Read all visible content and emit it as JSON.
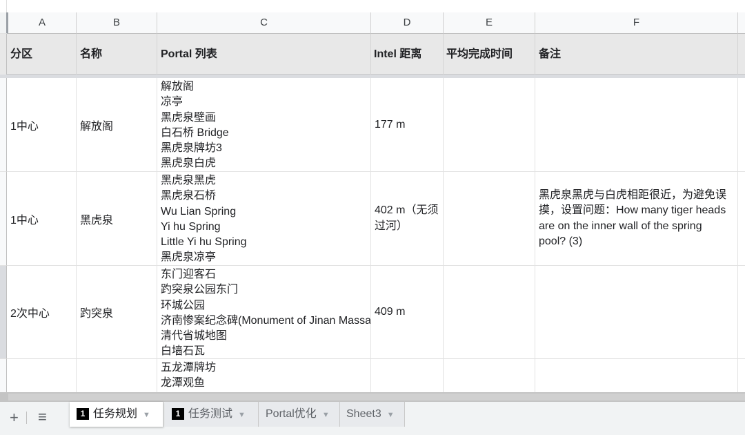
{
  "columns": [
    "A",
    "B",
    "C",
    "D",
    "E",
    "F"
  ],
  "header_row": {
    "zone": "分区",
    "name": "名称",
    "portals": "Portal 列表",
    "distance": "Intel 距离",
    "avg_time": "平均完成时间",
    "notes": "备注"
  },
  "rows": [
    {
      "zone": "1中心",
      "name": "解放阁",
      "portals": [
        "解放阁",
        "凉亭",
        "黑虎泉壁画",
        "白石桥 Bridge",
        "黑虎泉牌坊3",
        "黑虎泉白虎"
      ],
      "distance": "177 m",
      "avg_time": "",
      "notes": ""
    },
    {
      "zone": "1中心",
      "name": "黑虎泉",
      "portals": [
        "黑虎泉黑虎",
        "黑虎泉石桥",
        "Wu Lian Spring",
        "Yi hu Spring",
        "Little Yi hu Spring",
        "黑虎泉凉亭"
      ],
      "distance": "402 m（无须过河）",
      "avg_time": "",
      "notes": "黑虎泉黑虎与白虎相距很近，为避免误摸，设置问题：How many tiger heads are on the inner wall of the spring pool? (3)"
    },
    {
      "zone": "2次中心",
      "name": "趵突泉",
      "portals": [
        "东门迎客石",
        "趵突泉公园东门",
        "环城公园",
        "济南惨案纪念碑(Monument of Jinan Massacre)",
        "清代省城地图",
        "白墙石瓦"
      ],
      "distance": "409 m",
      "avg_time": "",
      "notes": ""
    },
    {
      "zone": "",
      "name": "",
      "portals": [
        "五龙潭牌坊",
        "龙潭观鱼"
      ],
      "distance": "",
      "avg_time": "",
      "notes": ""
    }
  ],
  "toolbar": {
    "add_icon": "plus-icon",
    "add_glyph": "+",
    "menu_icon": "sheet-list-icon",
    "menu_glyph": "≡"
  },
  "tabs": [
    {
      "badge": "1",
      "label": "任务规划",
      "active": true
    },
    {
      "badge": "1",
      "label": "任务测试",
      "active": false
    },
    {
      "badge": "",
      "label": "Portal优化",
      "active": false
    },
    {
      "badge": "",
      "label": "Sheet3",
      "active": false
    }
  ],
  "colors": {
    "header_fill": "#e8e8e8",
    "gridline": "#e2e2e2",
    "tab_bar": "#f1f3f4",
    "active_tab": "#ffffff"
  }
}
